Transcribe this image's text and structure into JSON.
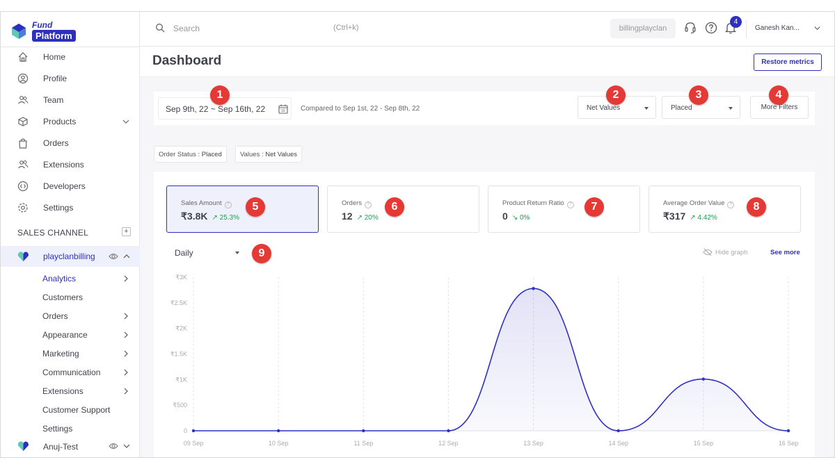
{
  "sidebar": {
    "logo_top": "Fund",
    "logo_bottom": "Platform",
    "nav": [
      {
        "label": "Home",
        "icon": "home-icon"
      },
      {
        "label": "Profile",
        "icon": "user-circle-icon"
      },
      {
        "label": "Team",
        "icon": "team-icon"
      },
      {
        "label": "Products",
        "icon": "box-icon"
      },
      {
        "label": "Orders",
        "icon": "bag-icon"
      },
      {
        "label": "Extensions",
        "icon": "people-icon"
      },
      {
        "label": "Developers",
        "icon": "code-icon"
      },
      {
        "label": "Settings",
        "icon": "gear-icon"
      }
    ],
    "sales_channel_label": "SALES CHANNEL",
    "channel_1": "playclanbilling",
    "channel_1_items": [
      "Analytics",
      "Customers",
      "Orders",
      "Appearance",
      "Marketing",
      "Communication",
      "Extensions",
      "Customer Support",
      "Settings"
    ],
    "channel_2": "Anuj-Test"
  },
  "topbar": {
    "search_placeholder": "Search",
    "search_shortcut": "(Ctrl+k)",
    "account": "billingplayclan",
    "notification_count": "4",
    "user_name": "Ganesh Kan..."
  },
  "main": {
    "page_title": "Dashboard",
    "restore_label": "Restore metrics",
    "date_range": "Sep 9th, 22 ~ Sep 16th, 22",
    "compared_text": "Compared to Sep 1st, 22 - Sep 8th, 22",
    "values_dropdown": "Net Values",
    "status_dropdown": "Placed",
    "more_filters": "More Filters",
    "chip_1_key": "Order Status : ",
    "chip_1_val": "Placed",
    "chip_2_key": "Values : ",
    "chip_2_val": "Net Values",
    "cards": [
      {
        "title": "Sales Amount",
        "value": "₹3.8K",
        "change": "↗ 25.3%"
      },
      {
        "title": "Orders",
        "value": "12",
        "change": "↗ 20%"
      },
      {
        "title": "Product Return Ratio",
        "value": "0",
        "change": "↘ 0%"
      },
      {
        "title": "Average Order Value",
        "value": "₹317",
        "change": "↗ 4.42%"
      }
    ],
    "period": "Daily",
    "hide_graph": "Hide graph",
    "see_more": "See more"
  },
  "markers": [
    "1",
    "2",
    "3",
    "4",
    "5",
    "6",
    "7",
    "8",
    "9"
  ],
  "colors": {
    "accent": "#2e31be",
    "marker": "#e53935",
    "positive": "#16a34a"
  },
  "chart_data": {
    "type": "area",
    "categories": [
      "09 Sep",
      "10 Sep",
      "11 Sep",
      "12 Sep",
      "13 Sep",
      "14 Sep",
      "15 Sep",
      "16 Sep"
    ],
    "values": [
      0,
      0,
      0,
      0,
      2780,
      0,
      1010,
      0
    ],
    "yticks": [
      "0",
      "₹500",
      "₹1K",
      "₹1.5K",
      "₹2K",
      "₹2.5K",
      "₹3K"
    ],
    "ylim": [
      0,
      3000
    ],
    "grid": "vertical dashed",
    "line_color": "#2e31be"
  }
}
